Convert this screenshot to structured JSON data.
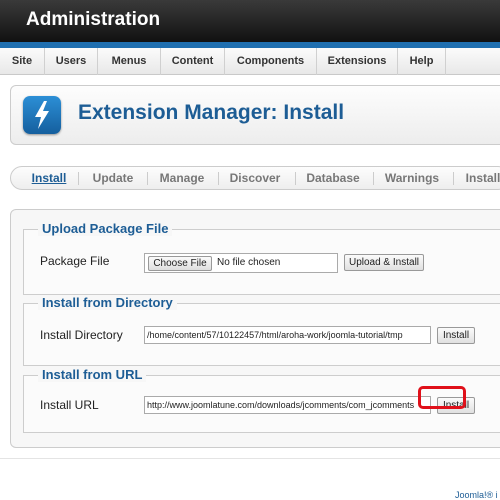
{
  "topbar": {
    "title": "Administration"
  },
  "menu": [
    {
      "label": "Site"
    },
    {
      "label": "Users"
    },
    {
      "label": "Menus"
    },
    {
      "label": "Content"
    },
    {
      "label": "Components"
    },
    {
      "label": "Extensions"
    },
    {
      "label": "Help"
    }
  ],
  "header": {
    "title": "Extension Manager: Install",
    "icon": "lightning-bolt-icon"
  },
  "tabs": [
    {
      "label": "Install",
      "active": true
    },
    {
      "label": "Update"
    },
    {
      "label": "Manage"
    },
    {
      "label": "Discover"
    },
    {
      "label": "Database"
    },
    {
      "label": "Warnings"
    },
    {
      "label": "Install"
    }
  ],
  "upload": {
    "legend": "Upload Package File",
    "label": "Package File",
    "choose_label": "Choose File",
    "file_status": "No file chosen",
    "button": "Upload & Install"
  },
  "directory": {
    "legend": "Install from Directory",
    "label": "Install Directory",
    "value": "/home/content/57/10122457/html/aroha-work/joomla-tutorial/tmp",
    "button": "Install"
  },
  "url": {
    "legend": "Install from URL",
    "label": "Install URL",
    "value": "http://www.joomlatune.com/downloads/jcomments/com_jcomments",
    "button": "Install"
  },
  "footer": {
    "text": "Joomla!® i"
  },
  "colors": {
    "accent": "#1d5d95",
    "highlight": "#e0101a",
    "topbar": "#1a1a1a",
    "stripe": "#1f6fb0"
  }
}
